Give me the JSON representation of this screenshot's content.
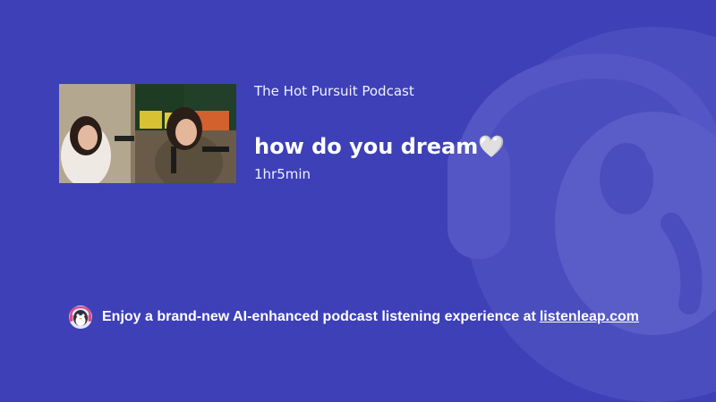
{
  "episode": {
    "show_name": "The Hot Pursuit Podcast",
    "title": "how do you dream🤍",
    "duration": "1hr5min"
  },
  "promo": {
    "text": "Enjoy a brand-new AI-enhanced podcast listening experience at",
    "link_text": "listenleap.com"
  },
  "icons": {
    "watermark": "mascot-watermark-icon",
    "promo": "penguin-mascot-icon"
  },
  "colors": {
    "background": "#3d40b7",
    "watermark": "#5356c4"
  }
}
